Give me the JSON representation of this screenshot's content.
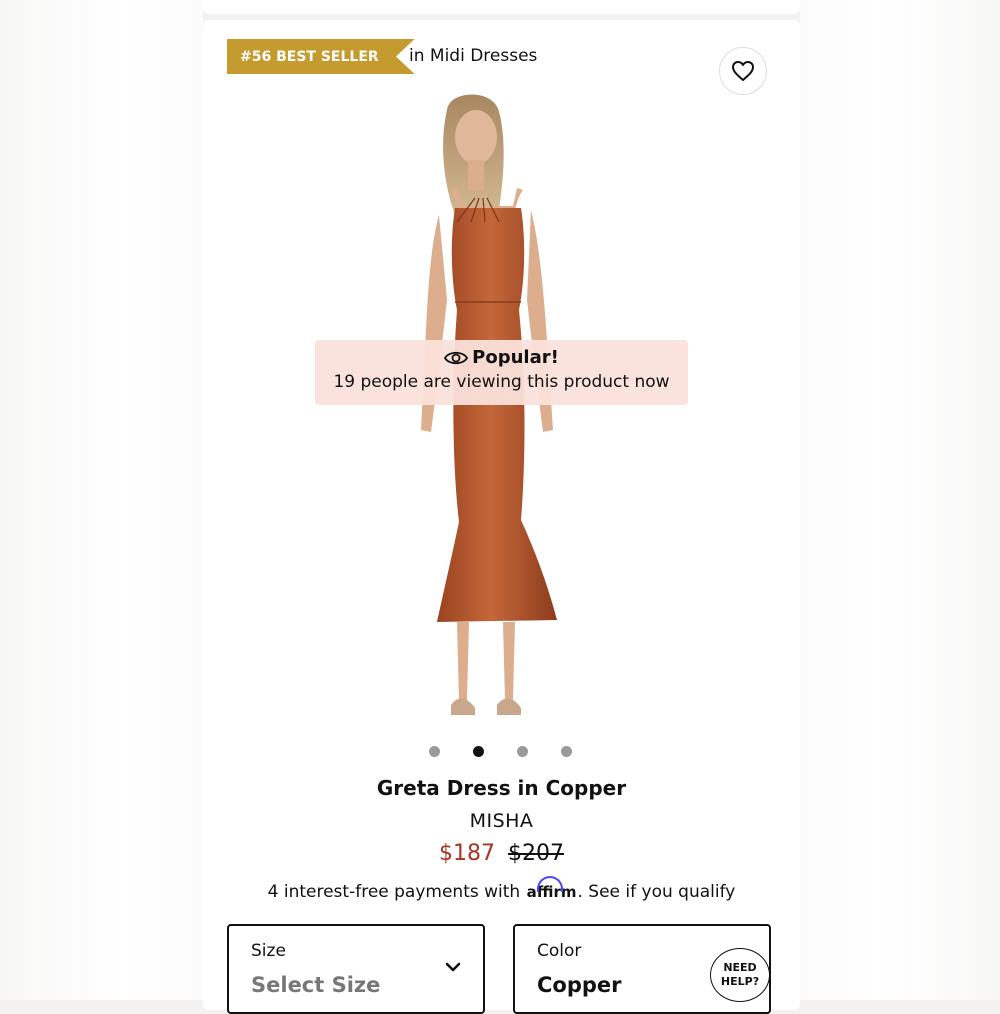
{
  "badge": {
    "rank_label": "#56 BEST SELLER",
    "context": "in Midi Dresses"
  },
  "popular": {
    "title": "Popular!",
    "text": "19 people are viewing this product now"
  },
  "carousel": {
    "count": 4,
    "active_index": 1
  },
  "product": {
    "name": "Greta Dress in Copper",
    "brand": "MISHA",
    "sale_price": "$187",
    "original_price": "$207"
  },
  "installments": {
    "prefix": "4 interest-free payments with",
    "logo": "affirm",
    "suffix": ". See if you qualify"
  },
  "size_select": {
    "label": "Size",
    "value": "Select Size"
  },
  "color_select": {
    "label": "Color",
    "value": "Copper"
  },
  "help": {
    "line1": "NEED",
    "line2": "HELP?"
  },
  "icons": [
    "heart-icon",
    "eye-icon",
    "chevron-down-icon"
  ],
  "colors": {
    "badge": "#c59a2f",
    "sale_price": "#a83424",
    "popular_bg": "#fae2da",
    "affirm": "#4a4af4",
    "dress": "#b8582a"
  }
}
